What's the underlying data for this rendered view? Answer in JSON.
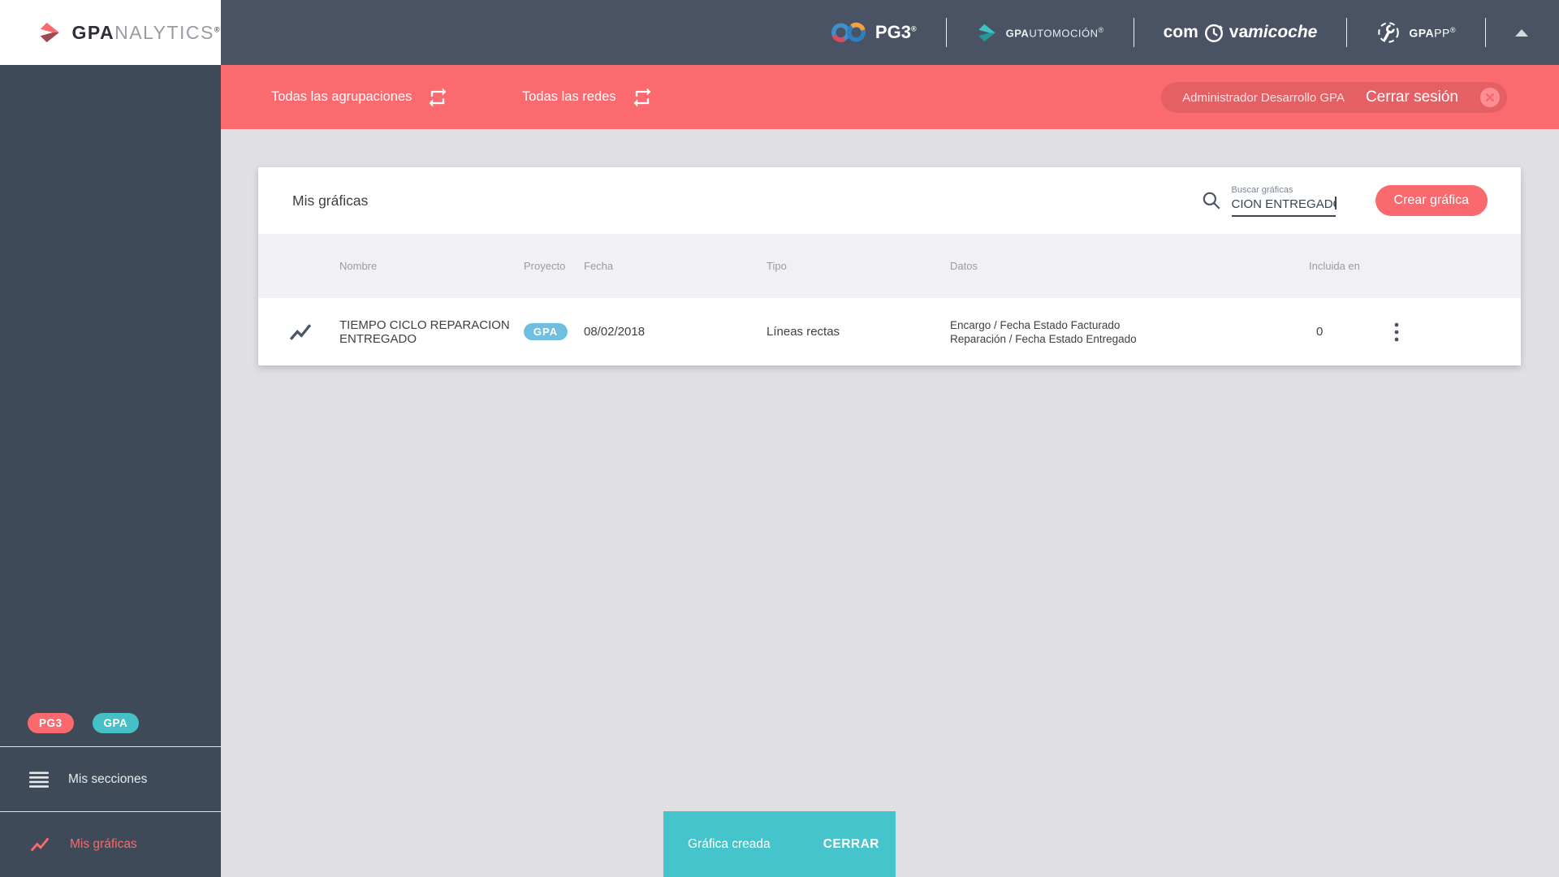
{
  "branding": {
    "logo": {
      "bold": "GPA",
      "light": "NALYTICS",
      "reg": "®"
    },
    "pg3": {
      "label": "PG3",
      "reg": "®"
    },
    "gpautomocion": {
      "bold": "GPA",
      "light": "UTOMOCIÓN",
      "reg": "®"
    },
    "compravamicoche": {
      "p1": "com",
      "p2": "va",
      "p3": "micoche"
    },
    "gpapp": {
      "bold": "GPA",
      "light": "PP",
      "reg": "®"
    }
  },
  "filterbar": {
    "groupings_label": "Todas las agrupaciones",
    "networks_label": "Todas las redes",
    "user_name": "Administrador Desarrollo GPA",
    "logout_label": "Cerrar sesión"
  },
  "sidebar": {
    "badges": [
      {
        "label": "PG3",
        "color": "#FA696E"
      },
      {
        "label": "GPA",
        "color": "#44C0C6"
      }
    ],
    "items": [
      {
        "label": "Mis secciones",
        "icon": "menu-icon",
        "active": false
      },
      {
        "label": "Mis gráficas",
        "icon": "chart-line-icon",
        "active": true
      }
    ]
  },
  "main": {
    "title": "Mis gráficas",
    "search": {
      "label": "Buscar gráficas",
      "value": "CION ENTREGADO"
    },
    "create_button": "Crear gráfica",
    "table": {
      "headers": [
        "Nombre",
        "Proyecto",
        "Fecha",
        "Tipo",
        "Datos",
        "Incluida en"
      ],
      "rows": [
        {
          "name_lines": [
            "TIEMPO CICLO REPARACION",
            "ENTREGADO"
          ],
          "project_badge": "GPA",
          "date": "08/02/2018",
          "type": "Líneas rectas",
          "data_lines": [
            "Encargo / Fecha Estado Facturado",
            "Reparación / Fecha Estado Entregado"
          ],
          "included_in": "0"
        }
      ]
    }
  },
  "toast": {
    "message": "Gráfica creada",
    "action": "CERRAR"
  },
  "colors": {
    "topbar": "#4A5363",
    "sidebar": "#3E4A58",
    "accent_coral": "#FB6A6E",
    "accent_teal": "#44C0C6",
    "toast_teal": "#46C4CB",
    "badge_blue": "#70BFE0",
    "page_bg": "#E0E0E4",
    "table_header_bg": "#F1F1F4"
  }
}
